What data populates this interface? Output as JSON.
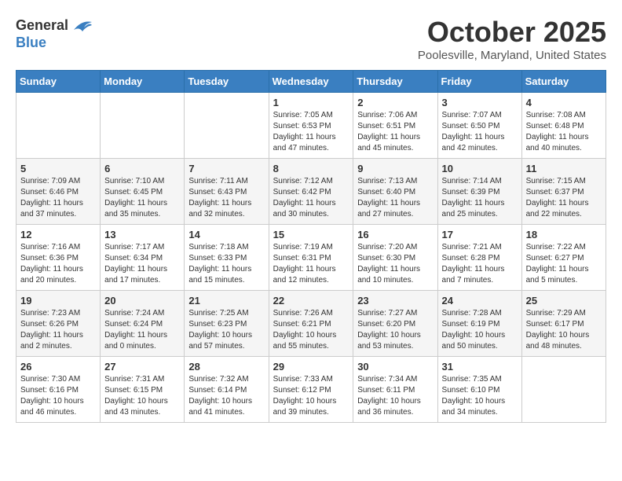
{
  "header": {
    "logo_general": "General",
    "logo_blue": "Blue",
    "month_title": "October 2025",
    "location": "Poolesville, Maryland, United States"
  },
  "days_of_week": [
    "Sunday",
    "Monday",
    "Tuesday",
    "Wednesday",
    "Thursday",
    "Friday",
    "Saturday"
  ],
  "weeks": [
    [
      {
        "day": "",
        "info": ""
      },
      {
        "day": "",
        "info": ""
      },
      {
        "day": "",
        "info": ""
      },
      {
        "day": "1",
        "info": "Sunrise: 7:05 AM\nSunset: 6:53 PM\nDaylight: 11 hours and 47 minutes."
      },
      {
        "day": "2",
        "info": "Sunrise: 7:06 AM\nSunset: 6:51 PM\nDaylight: 11 hours and 45 minutes."
      },
      {
        "day": "3",
        "info": "Sunrise: 7:07 AM\nSunset: 6:50 PM\nDaylight: 11 hours and 42 minutes."
      },
      {
        "day": "4",
        "info": "Sunrise: 7:08 AM\nSunset: 6:48 PM\nDaylight: 11 hours and 40 minutes."
      }
    ],
    [
      {
        "day": "5",
        "info": "Sunrise: 7:09 AM\nSunset: 6:46 PM\nDaylight: 11 hours and 37 minutes."
      },
      {
        "day": "6",
        "info": "Sunrise: 7:10 AM\nSunset: 6:45 PM\nDaylight: 11 hours and 35 minutes."
      },
      {
        "day": "7",
        "info": "Sunrise: 7:11 AM\nSunset: 6:43 PM\nDaylight: 11 hours and 32 minutes."
      },
      {
        "day": "8",
        "info": "Sunrise: 7:12 AM\nSunset: 6:42 PM\nDaylight: 11 hours and 30 minutes."
      },
      {
        "day": "9",
        "info": "Sunrise: 7:13 AM\nSunset: 6:40 PM\nDaylight: 11 hours and 27 minutes."
      },
      {
        "day": "10",
        "info": "Sunrise: 7:14 AM\nSunset: 6:39 PM\nDaylight: 11 hours and 25 minutes."
      },
      {
        "day": "11",
        "info": "Sunrise: 7:15 AM\nSunset: 6:37 PM\nDaylight: 11 hours and 22 minutes."
      }
    ],
    [
      {
        "day": "12",
        "info": "Sunrise: 7:16 AM\nSunset: 6:36 PM\nDaylight: 11 hours and 20 minutes."
      },
      {
        "day": "13",
        "info": "Sunrise: 7:17 AM\nSunset: 6:34 PM\nDaylight: 11 hours and 17 minutes."
      },
      {
        "day": "14",
        "info": "Sunrise: 7:18 AM\nSunset: 6:33 PM\nDaylight: 11 hours and 15 minutes."
      },
      {
        "day": "15",
        "info": "Sunrise: 7:19 AM\nSunset: 6:31 PM\nDaylight: 11 hours and 12 minutes."
      },
      {
        "day": "16",
        "info": "Sunrise: 7:20 AM\nSunset: 6:30 PM\nDaylight: 11 hours and 10 minutes."
      },
      {
        "day": "17",
        "info": "Sunrise: 7:21 AM\nSunset: 6:28 PM\nDaylight: 11 hours and 7 minutes."
      },
      {
        "day": "18",
        "info": "Sunrise: 7:22 AM\nSunset: 6:27 PM\nDaylight: 11 hours and 5 minutes."
      }
    ],
    [
      {
        "day": "19",
        "info": "Sunrise: 7:23 AM\nSunset: 6:26 PM\nDaylight: 11 hours and 2 minutes."
      },
      {
        "day": "20",
        "info": "Sunrise: 7:24 AM\nSunset: 6:24 PM\nDaylight: 11 hours and 0 minutes."
      },
      {
        "day": "21",
        "info": "Sunrise: 7:25 AM\nSunset: 6:23 PM\nDaylight: 10 hours and 57 minutes."
      },
      {
        "day": "22",
        "info": "Sunrise: 7:26 AM\nSunset: 6:21 PM\nDaylight: 10 hours and 55 minutes."
      },
      {
        "day": "23",
        "info": "Sunrise: 7:27 AM\nSunset: 6:20 PM\nDaylight: 10 hours and 53 minutes."
      },
      {
        "day": "24",
        "info": "Sunrise: 7:28 AM\nSunset: 6:19 PM\nDaylight: 10 hours and 50 minutes."
      },
      {
        "day": "25",
        "info": "Sunrise: 7:29 AM\nSunset: 6:17 PM\nDaylight: 10 hours and 48 minutes."
      }
    ],
    [
      {
        "day": "26",
        "info": "Sunrise: 7:30 AM\nSunset: 6:16 PM\nDaylight: 10 hours and 46 minutes."
      },
      {
        "day": "27",
        "info": "Sunrise: 7:31 AM\nSunset: 6:15 PM\nDaylight: 10 hours and 43 minutes."
      },
      {
        "day": "28",
        "info": "Sunrise: 7:32 AM\nSunset: 6:14 PM\nDaylight: 10 hours and 41 minutes."
      },
      {
        "day": "29",
        "info": "Sunrise: 7:33 AM\nSunset: 6:12 PM\nDaylight: 10 hours and 39 minutes."
      },
      {
        "day": "30",
        "info": "Sunrise: 7:34 AM\nSunset: 6:11 PM\nDaylight: 10 hours and 36 minutes."
      },
      {
        "day": "31",
        "info": "Sunrise: 7:35 AM\nSunset: 6:10 PM\nDaylight: 10 hours and 34 minutes."
      },
      {
        "day": "",
        "info": ""
      }
    ]
  ]
}
